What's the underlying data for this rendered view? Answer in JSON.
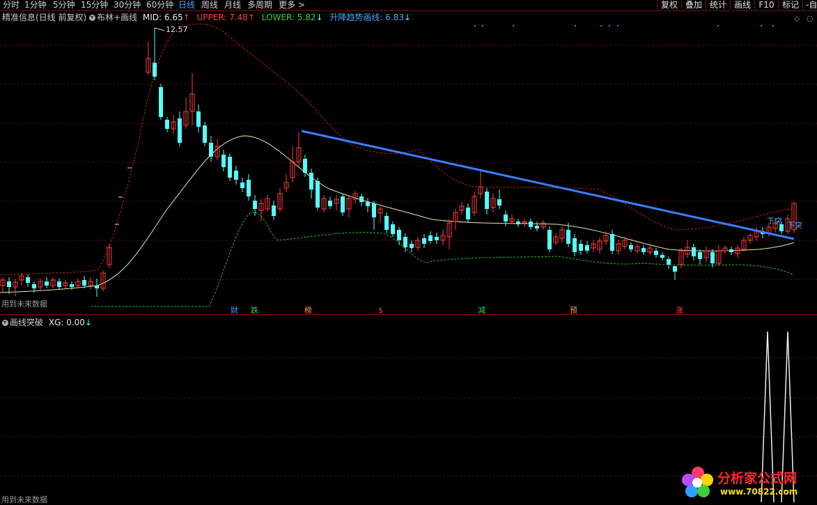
{
  "toolbar": {
    "periods": [
      "分时",
      "1分钟",
      "5分钟",
      "15分钟",
      "30分钟",
      "60分钟",
      "日线",
      "周线",
      "月线",
      "多周期",
      "更多"
    ],
    "active_period": "日线",
    "right_buttons": [
      "复权",
      "叠加",
      "统计",
      "画线",
      "F10",
      "标记",
      "-自"
    ]
  },
  "main_panel": {
    "title": "精准信息(日线 前复权)",
    "indicator_name": "布林+画线",
    "mid_label": "MID: 6.65",
    "upper_label": "UPPER: 7.48",
    "lower_label": "LOWER: 5.82",
    "trend_label": "升降趋势画线: 6.83",
    "high_price_label": "12.57",
    "break_label_1": "下突",
    "break_label_2": "下突",
    "signals": [
      "财",
      "跌",
      "榜",
      "$",
      "减",
      "预",
      "涨"
    ],
    "hint": "用到未来数据",
    "colors": {
      "up": "#ff3b3b",
      "down": "#54ffff",
      "mid": "#e8e8a0",
      "upper": "#c02020",
      "lower": "#20c020",
      "trend": "#3a7fff"
    }
  },
  "sub_panel": {
    "indicator_name": "画线突破",
    "xg_label": "XG: 0.00",
    "hint": "用到未来数据"
  },
  "watermark": {
    "text": "分析家公式网",
    "url": "www.70822.com"
  }
}
